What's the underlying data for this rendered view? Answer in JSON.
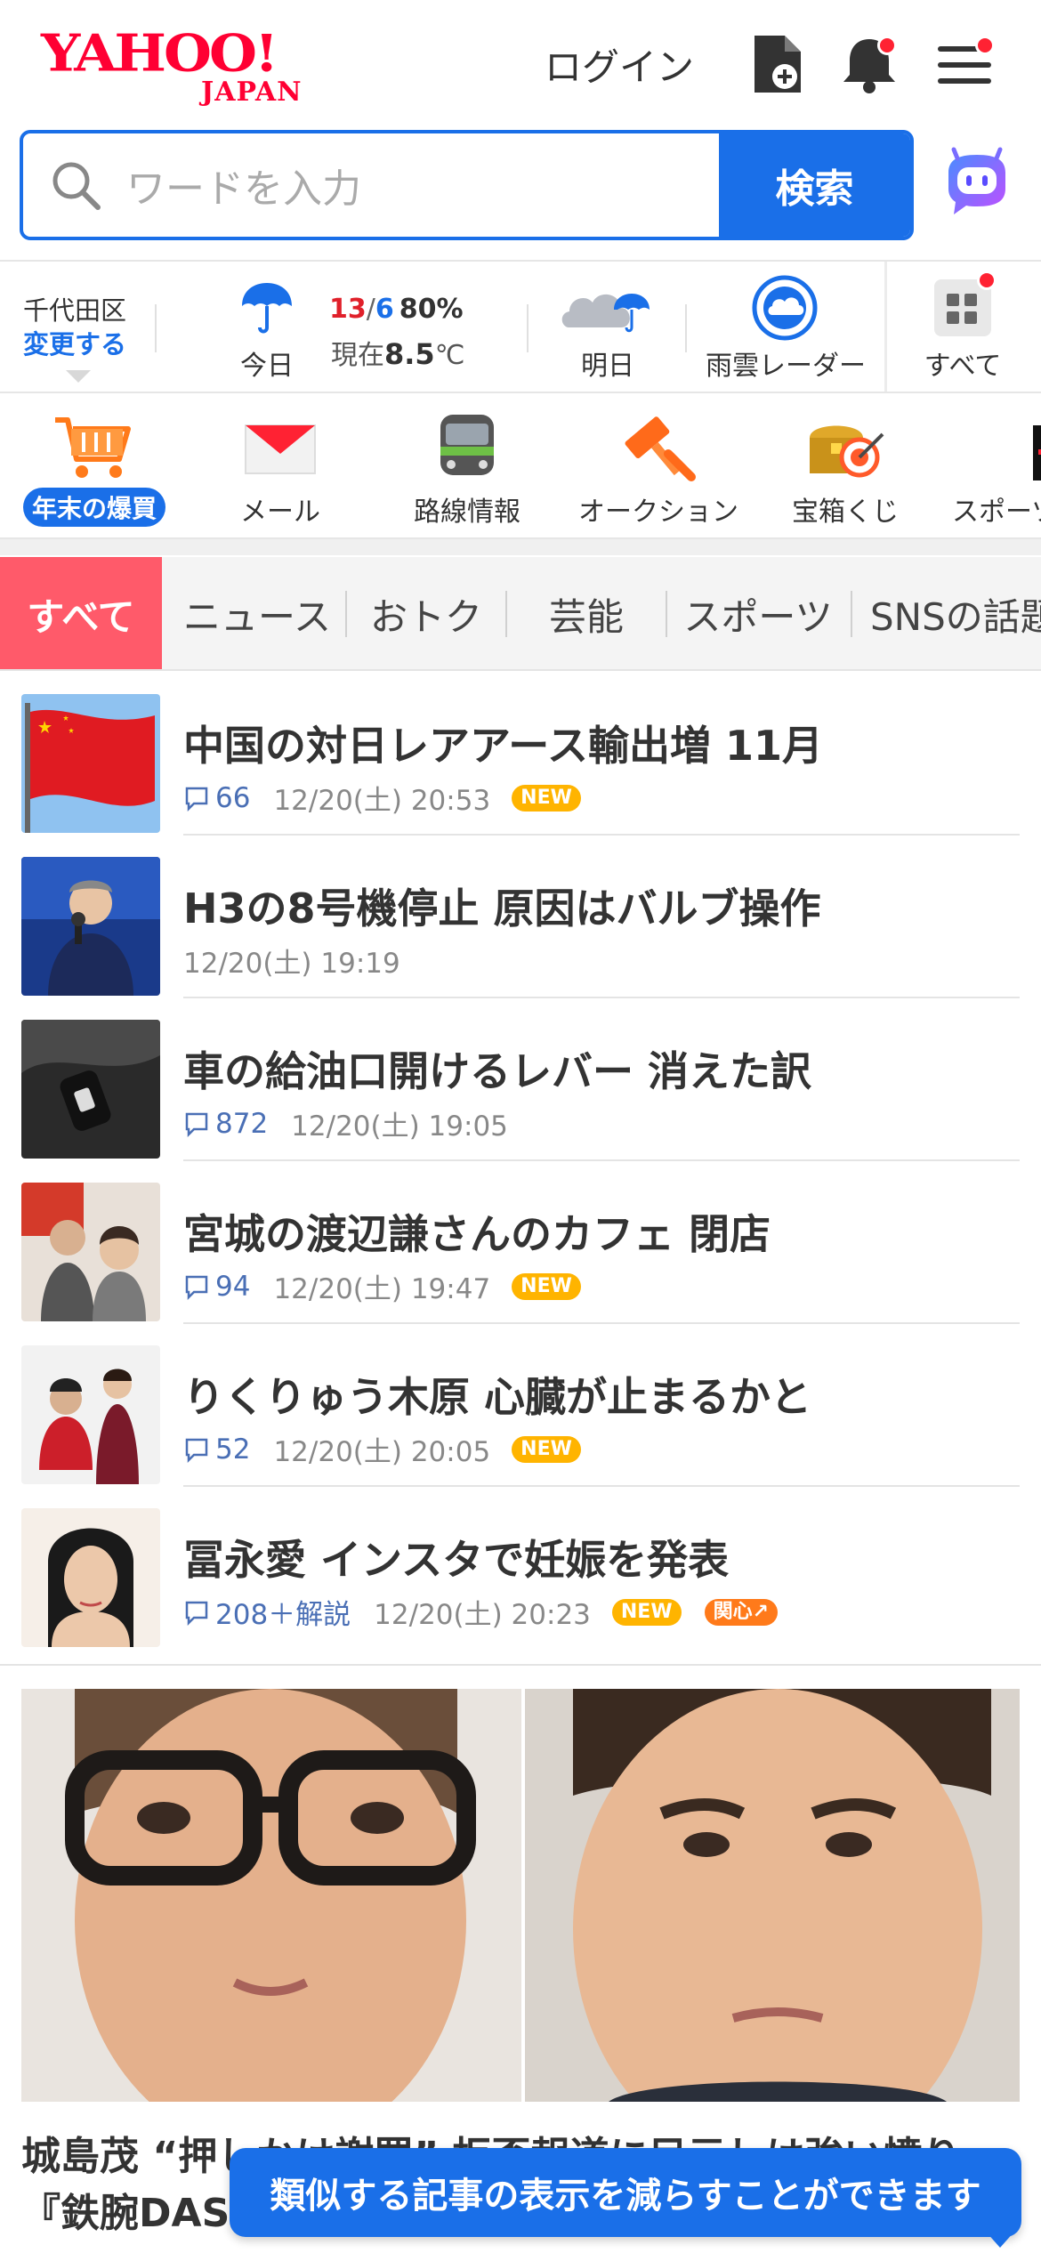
{
  "header": {
    "logo_main": "YAHOO!",
    "logo_sub": "JAPAN",
    "login_label": "ログイン"
  },
  "search": {
    "placeholder": "ワードを入力",
    "button_label": "検索"
  },
  "weather": {
    "location": "千代田区",
    "change_label": "変更する",
    "today_label": "今日",
    "high": "13",
    "low": "6",
    "rain_chance": "80%",
    "now_prefix": "現在",
    "now_temp": "8.5",
    "now_unit": "℃",
    "tomorrow_label": "明日",
    "radar_label": "雨雲レーダー",
    "all_label": "すべて"
  },
  "services": [
    {
      "label": "年末の爆買",
      "icon": "shopping-cart-icon"
    },
    {
      "label": "メール",
      "icon": "mail-icon"
    },
    {
      "label": "路線情報",
      "icon": "train-icon"
    },
    {
      "label": "オークション",
      "icon": "auction-gavel-icon"
    },
    {
      "label": "宝箱くじ",
      "icon": "treasure-box-icon"
    },
    {
      "label": "スポーツ",
      "icon": "sports-icon"
    }
  ],
  "tabs": [
    {
      "label": "すべて",
      "active": true
    },
    {
      "label": "ニュース"
    },
    {
      "label": "おトク"
    },
    {
      "label": "芸能"
    },
    {
      "label": "スポーツ"
    },
    {
      "label": "SNSの話題"
    }
  ],
  "news": [
    {
      "title": "中国の対日レアアース輸出増 11月",
      "comments": "66",
      "datetime": "12/20(土) 20:53",
      "badge": "NEW"
    },
    {
      "title": "H3の8号機停止 原因はバルブ操作",
      "comments": "",
      "datetime": "12/20(土) 19:19",
      "badge": ""
    },
    {
      "title": "車の給油口開けるレバー 消えた訳",
      "comments": "872",
      "datetime": "12/20(土) 19:05",
      "badge": ""
    },
    {
      "title": "宮城の渡辺謙さんのカフェ 閉店",
      "comments": "94",
      "datetime": "12/20(土) 19:47",
      "badge": "NEW"
    },
    {
      "title": "りくりゅう木原 心臓が止まるかと",
      "comments": "52",
      "datetime": "12/20(土) 20:05",
      "badge": "NEW"
    },
    {
      "title": "冨永愛 インスタで妊娠を発表",
      "comments": "208＋解説",
      "datetime": "12/20(土) 20:23",
      "badge": "NEW",
      "badge2": "関心↗"
    }
  ],
  "feature": {
    "title": "城島茂 “押しかけ謝罪” 拒否報道に目元しは強い憤り…『鉄腕DASH』"
  },
  "toast": {
    "text": "類似する記事の表示を減らすことができます"
  },
  "colors": {
    "brand_red": "#ff0033",
    "accent_blue": "#1a6fe8",
    "tab_active": "#ff5a6a",
    "badge_new": "#ffb400"
  }
}
